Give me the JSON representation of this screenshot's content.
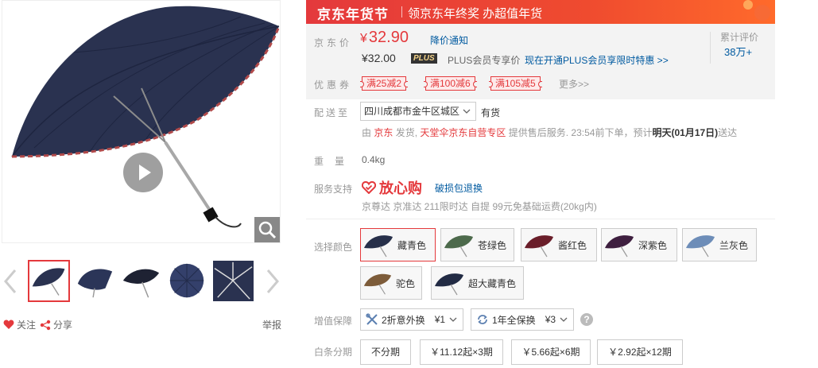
{
  "gallery": {
    "social": {
      "follow": "关注",
      "share": "分享",
      "report": "举报"
    },
    "thumbnails": [
      "navy-umbrella-open",
      "navy-umbrella-side",
      "black-umbrella-open",
      "navy-umbrella-top",
      "umbrella-ribs-inside"
    ]
  },
  "banner": {
    "title": "京东年货节",
    "subtitle": "领京东年终奖 办超值年货"
  },
  "price": {
    "label": "京东价",
    "currency": "¥",
    "value": "32.90",
    "notify": "降价通知",
    "plus_price": "¥32.00",
    "plus_tag": "PLUS",
    "plus_text": "PLUS会员专享价",
    "plus_link": "现在开通PLUS会员享限时特惠 >>",
    "review_label": "累计评价",
    "review_count": "38万+"
  },
  "coupons": {
    "label": "优惠券",
    "items": [
      "满25减2",
      "满100减6",
      "满105减5"
    ],
    "more": "更多>>"
  },
  "delivery": {
    "label": "配送至",
    "address": "四川成都市金牛区城区",
    "stock": "有货",
    "ship_prefix": "由",
    "ship_from": "京东",
    "ship_mid": "发货,",
    "store": "天堂伞京东自营专区",
    "ship_suffix": "提供售后服务. 23:54前下单，预计",
    "eta": "明天(01月17日)",
    "eta_suffix": "送达"
  },
  "weight": {
    "label": "重量",
    "value": "0.4kg"
  },
  "service": {
    "label": "服务支持",
    "brand": "放心购",
    "link": "破损包退换",
    "details": "京尊达  京准达  211限时达  自提  99元免基础运费(20kg内)"
  },
  "colors": {
    "label": "选择颜色",
    "options": [
      {
        "name": "藏青色",
        "hex": "#27304a",
        "selected": true
      },
      {
        "name": "苍绿色",
        "hex": "#4d6a4c",
        "selected": false
      },
      {
        "name": "酱红色",
        "hex": "#6a1e2a",
        "selected": false
      },
      {
        "name": "深紫色",
        "hex": "#3e1f3f",
        "selected": false
      },
      {
        "name": "兰灰色",
        "hex": "#6d8db8",
        "selected": false
      },
      {
        "name": "驼色",
        "hex": "#7d5c3a",
        "selected": false
      },
      {
        "name": "超大藏青色",
        "hex": "#222b44",
        "selected": false
      }
    ]
  },
  "warranty": {
    "label": "增值保障",
    "options": [
      {
        "name": "2折意外换",
        "price": "¥1"
      },
      {
        "name": "1年全保换",
        "price": "¥3"
      }
    ],
    "help": "?"
  },
  "installment": {
    "label": "白条分期",
    "options": [
      "不分期",
      "￥11.12起×3期",
      "￥5.66起×6期",
      "￥2.92起×12期"
    ]
  },
  "theme": {
    "accent": "#e4393c",
    "link": "#005aa0",
    "umbrella": "#2a3250"
  }
}
